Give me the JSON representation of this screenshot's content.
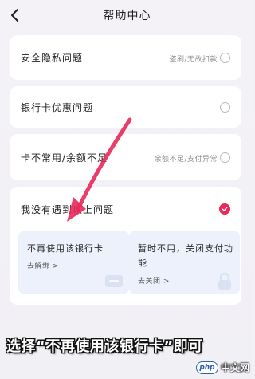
{
  "header": {
    "title": "帮助中心"
  },
  "rows": [
    {
      "label": "安全隐私问题",
      "hint": "盗刷/无故扣款",
      "checked": false
    },
    {
      "label": "银行卡优惠问题",
      "hint": "",
      "checked": false
    },
    {
      "label": "卡不常用/余额不足",
      "hint": "余额不足/支付异常",
      "checked": false
    },
    {
      "label": "我没有遇到以上问题",
      "hint": "",
      "checked": true
    }
  ],
  "options": [
    {
      "title": "不再使用该银行卡",
      "link": "去解绑 >"
    },
    {
      "title": "暂时不用，关闭支付功能",
      "link": "去关闭 >"
    }
  ],
  "caption": "选择“不再使用该银行卡”即可",
  "watermark": {
    "badge": "php",
    "text": "中文网"
  },
  "colors": {
    "accent": "#e8295a",
    "arrow": "#e8295a",
    "background": "#f3f1f6",
    "option_bg": "#edf1fb"
  }
}
